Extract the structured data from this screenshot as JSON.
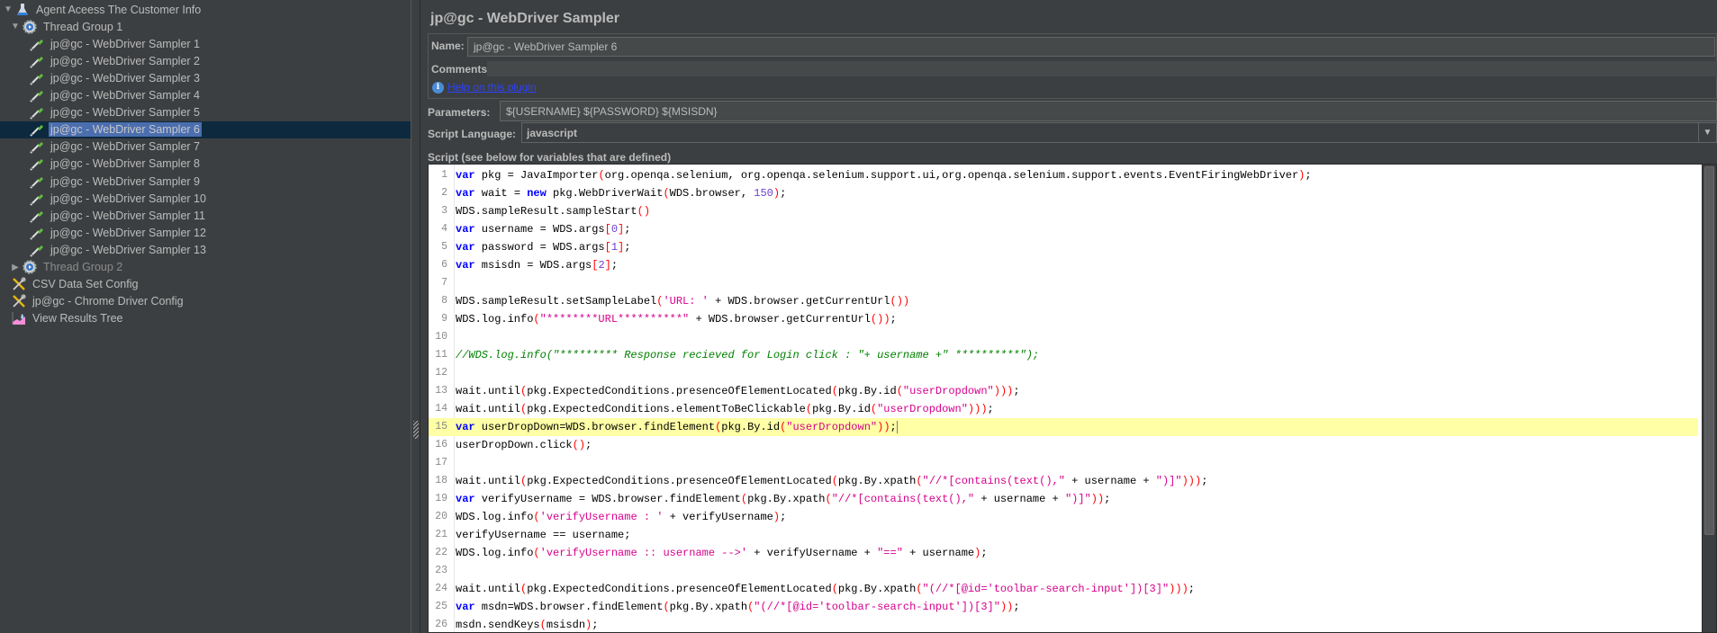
{
  "tree": {
    "items": [
      {
        "label": "Agent Aceess The Customer Info",
        "icon": "test-plan-flask-icon",
        "level": 0,
        "toggle": "expanded"
      },
      {
        "label": "Thread Group 1",
        "icon": "thread-group-gear-icon",
        "level": 1,
        "toggle": "expanded"
      },
      {
        "label": "jp@gc - WebDriver Sampler 1",
        "icon": "pipette-sampler-icon",
        "level": 2
      },
      {
        "label": "jp@gc - WebDriver Sampler 2",
        "icon": "pipette-sampler-icon",
        "level": 2
      },
      {
        "label": "jp@gc - WebDriver Sampler 3",
        "icon": "pipette-sampler-icon",
        "level": 2
      },
      {
        "label": "jp@gc - WebDriver Sampler 4",
        "icon": "pipette-sampler-icon",
        "level": 2
      },
      {
        "label": "jp@gc - WebDriver Sampler 5",
        "icon": "pipette-sampler-icon",
        "level": 2
      },
      {
        "label": "jp@gc - WebDriver Sampler 6",
        "icon": "pipette-sampler-icon",
        "level": 2,
        "selected": true
      },
      {
        "label": "jp@gc - WebDriver Sampler 7",
        "icon": "pipette-sampler-icon",
        "level": 2
      },
      {
        "label": "jp@gc - WebDriver Sampler 8",
        "icon": "pipette-sampler-icon",
        "level": 2
      },
      {
        "label": "jp@gc - WebDriver Sampler 9",
        "icon": "pipette-sampler-icon",
        "level": 2
      },
      {
        "label": "jp@gc - WebDriver Sampler 10",
        "icon": "pipette-sampler-icon",
        "level": 2
      },
      {
        "label": "jp@gc - WebDriver Sampler 11",
        "icon": "pipette-sampler-icon",
        "level": 2
      },
      {
        "label": "jp@gc - WebDriver Sampler 12",
        "icon": "pipette-sampler-icon",
        "level": 2
      },
      {
        "label": "jp@gc - WebDriver Sampler 13",
        "icon": "pipette-sampler-icon",
        "level": 2
      },
      {
        "label": "Thread Group 2",
        "icon": "thread-group-gear-icon",
        "level": 1,
        "toggle": "collapsed",
        "disabled": true
      },
      {
        "label": "CSV Data Set Config",
        "icon": "config-tools-icon",
        "level": 1
      },
      {
        "label": "jp@gc - Chrome Driver Config",
        "icon": "config-tools-icon",
        "level": 1
      },
      {
        "label": "View Results Tree",
        "icon": "results-chart-icon",
        "level": 1
      }
    ]
  },
  "panel": {
    "title": "jp@gc - WebDriver Sampler",
    "name_label": "Name:",
    "name_value": "jp@gc - WebDriver Sampler 6",
    "comments_label": "Comments:",
    "comments_value": "",
    "help_link": "Help on this plugin",
    "parameters_label": "Parameters:",
    "parameters_value": "${USERNAME} ${PASSWORD} ${MSISDN}",
    "script_language_label": "Script Language:",
    "script_language_value": "javascript",
    "script_label": "Script (see below for variables that are defined)"
  },
  "editor": {
    "current_line": 15,
    "lines": [
      "var pkg = JavaImporter(org.openqa.selenium, org.openqa.selenium.support.ui,org.openqa.selenium.support.events.EventFiringWebDriver);",
      "var wait = new pkg.WebDriverWait(WDS.browser, 150);",
      "WDS.sampleResult.sampleStart()",
      "var username = WDS.args[0];",
      "var password = WDS.args[1];",
      "var msisdn = WDS.args[2];",
      "",
      "WDS.sampleResult.setSampleLabel('URL: ' + WDS.browser.getCurrentUrl())",
      "WDS.log.info(\"********URL**********\" + WDS.browser.getCurrentUrl());",
      "",
      "//WDS.log.info(\"********* Response recieved for Login click : \"+ username +\" **********\");",
      "",
      "wait.until(pkg.ExpectedConditions.presenceOfElementLocated(pkg.By.id(\"userDropdown\")));",
      "wait.until(pkg.ExpectedConditions.elementToBeClickable(pkg.By.id(\"userDropdown\")));",
      "var userDropDown=WDS.browser.findElement(pkg.By.id(\"userDropdown\"));",
      "userDropDown.click();",
      "",
      "wait.until(pkg.ExpectedConditions.presenceOfElementLocated(pkg.By.xpath(\"//*[contains(text(),\" + username + \")]\")));",
      "var verifyUsername = WDS.browser.findElement(pkg.By.xpath(\"//*[contains(text(),\" + username + \")]\"));",
      "WDS.log.info('verifyUsername : ' + verifyUsername);",
      "verifyUsername == username;",
      "WDS.log.info('verifyUsername :: username -->' + verifyUsername + \"==\" + username);",
      "",
      "wait.until(pkg.ExpectedConditions.presenceOfElementLocated(pkg.By.xpath(\"(//*[@id='toolbar-search-input'])[3]\")));",
      "var msdn=WDS.browser.findElement(pkg.By.xpath(\"(//*[@id='toolbar-search-input'])[3]\"));",
      "msdn.sendKeys(msisdn);"
    ]
  },
  "colors": {
    "background": "#3c3f41",
    "selection": "#4b6eaf",
    "selected_row": "#0d293e",
    "current_line": "#ffffa6",
    "keyword": "#0000ff",
    "string": "#d6008c",
    "bracket": "#ff0000",
    "number": "#6b3fd0",
    "comment": "#008000",
    "link": "#2b43ff"
  }
}
